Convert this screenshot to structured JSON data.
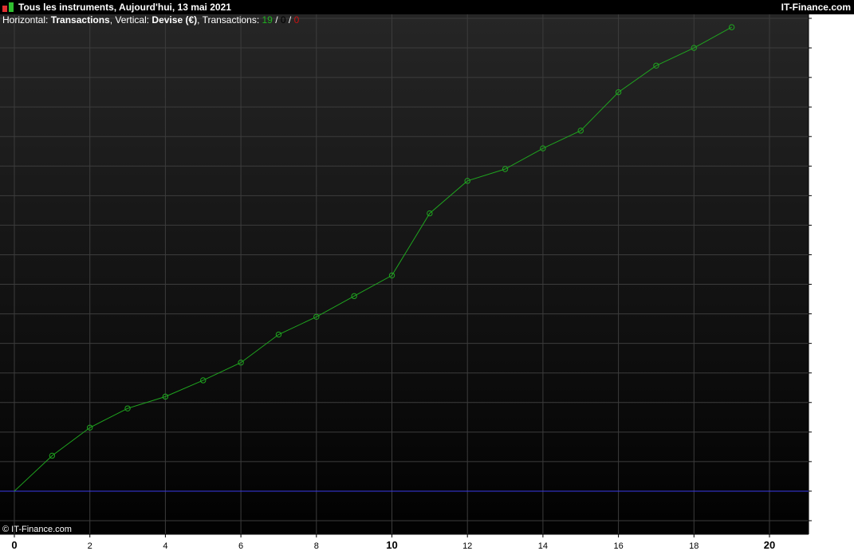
{
  "window": {
    "title": "Tous les instruments, Aujourd'hui, 13 mai 2021",
    "brand": "IT-Finance.com"
  },
  "info": {
    "horizontal_label": "Horizontal: ",
    "horizontal_value": "Transactions",
    "vertical_label": ", Vertical: ",
    "vertical_value": "Devise (€)",
    "transactions_label": ", Transactions: ",
    "count_win": "19",
    "count_flat": "0",
    "count_loss": "0",
    "separator": " / "
  },
  "copyright": "© IT-Finance.com",
  "colors": {
    "line": "#1fa51f",
    "baseline": "#3a3ae8",
    "win": "#1fb31f",
    "loss": "#cc1111",
    "background_top": "#262626",
    "background_bottom": "#000000"
  },
  "chart_data": {
    "type": "line",
    "title": "",
    "xlabel": "Transactions",
    "ylabel": "Devise (€)",
    "xlim": [
      0,
      21
    ],
    "ylim": [
      -1,
      16
    ],
    "x_ticks": [
      0,
      2,
      4,
      6,
      8,
      10,
      12,
      14,
      16,
      18,
      20
    ],
    "x_tick_labels": [
      "0",
      "2",
      "4",
      "6",
      "8",
      "10",
      "12",
      "14",
      "16",
      "18",
      "20"
    ],
    "x_tick_bold": [
      true,
      false,
      false,
      false,
      false,
      true,
      false,
      false,
      false,
      false,
      true
    ],
    "y_gridlines": [
      -1,
      0,
      1,
      2,
      3,
      4,
      5,
      6,
      7,
      8,
      9,
      10,
      11,
      12,
      13,
      14,
      15,
      16
    ],
    "baseline_y": 0,
    "grid": true,
    "legend": "none",
    "series": [
      {
        "x": [
          0,
          1,
          2,
          3,
          4,
          5,
          6,
          7,
          8,
          9,
          10,
          11,
          12,
          13,
          14,
          15,
          16,
          17,
          18,
          19
        ],
        "values": [
          0,
          1.2,
          2.15,
          2.8,
          3.2,
          3.75,
          4.35,
          5.3,
          5.9,
          6.6,
          7.3,
          9.4,
          10.5,
          10.9,
          11.6,
          12.2,
          13.5,
          14.4,
          15.0,
          15.7
        ]
      }
    ]
  }
}
